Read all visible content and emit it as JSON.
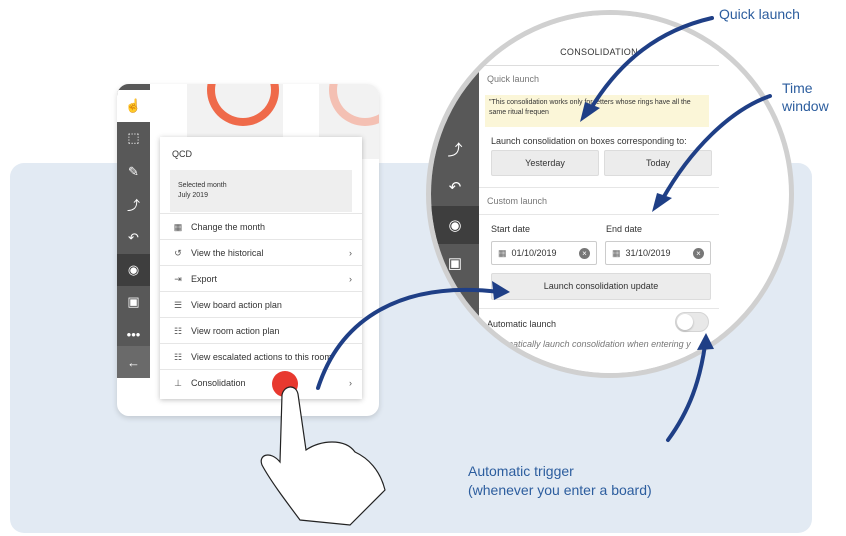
{
  "menu": {
    "title": "QCD",
    "selected_label": "Selected month",
    "selected_value": "July 2019",
    "items": [
      {
        "label": "Change the month",
        "chevron": false
      },
      {
        "label": "View the historical",
        "chevron": true
      },
      {
        "label": "Export",
        "chevron": true
      },
      {
        "label": "View board action plan",
        "chevron": false
      },
      {
        "label": "View room action plan",
        "chevron": false
      },
      {
        "label": "View escalated actions to this room",
        "chevron": false
      },
      {
        "label": "Consolidation",
        "chevron": true
      }
    ],
    "chevron": "›"
  },
  "panel": {
    "header": "CONSOLIDATION",
    "quick_launch": "Quick launch",
    "note": "\"This consolidation works only for letters whose rings have all the same ritual frequen",
    "launch_on": "Launch consolidation on boxes corresponding to:",
    "yesterday": "Yesterday",
    "today": "Today",
    "custom_launch": "Custom launch",
    "start_date_label": "Start date",
    "end_date_label": "End date",
    "start_date": "01/10/2019",
    "end_date": "31/10/2019",
    "update_button": "Launch consolidation update",
    "automatic_launch": "Automatic launch",
    "automatic_desc": "Automatically launch consolidation when entering y",
    "automatic_enabled": false
  },
  "callouts": {
    "quick_launch": "Quick launch",
    "time_window_1": "Time",
    "time_window_2": "window",
    "auto_trigger_1": "Automatic trigger",
    "auto_trigger_2": "(whenever you enter a board)"
  },
  "colors": {
    "accent_red": "#e8392f",
    "annotation_blue": "#2c5d9e",
    "toolbar_grey": "#585858",
    "background_panel": "#e2eaf3"
  }
}
